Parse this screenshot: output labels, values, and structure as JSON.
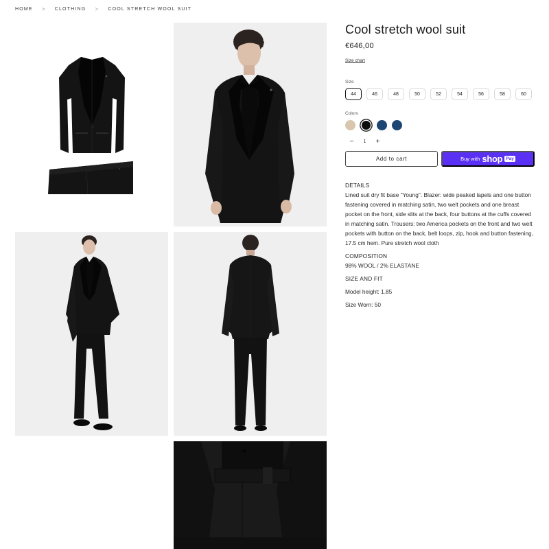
{
  "breadcrumb": {
    "items": [
      "HOME",
      "CLOTHING",
      "COOL STRETCH WOOL SUIT"
    ],
    "separator": ">"
  },
  "product": {
    "title": "Cool stretch wool suit",
    "price": "€646,00",
    "size_chart_label": "Size chart",
    "size_label": "Size",
    "sizes": [
      "44",
      "46",
      "48",
      "50",
      "52",
      "54",
      "56",
      "58",
      "60"
    ],
    "selected_size": "44",
    "colors_label": "Colors",
    "colors": [
      "#d8c7ae",
      "#0d0d0d",
      "#1d4673",
      "#1d4673"
    ],
    "selected_color_index": 1,
    "quantity": "1",
    "qty_minus": "−",
    "qty_plus": "+",
    "add_to_cart": "Add to cart",
    "buy_with": "Buy with",
    "shop_word": "shop",
    "pay_word": "Pay"
  },
  "details": {
    "details_heading": "DETAILS",
    "description": "Lined suit dry fit base \"Young\". Blazer: wide peaked lapels and one button fastening covered in matching satin, two welt pockets and one breast pocket on the front, side slits at the back, four buttons at the cuffs covered in matching satin. Trousers: two America pockets on the front and two welt pockets with button on the back, belt loops, zip, hook and button fastening, 17.5 cm hem. Pure stretch wool cloth",
    "composition_heading": "COMPOSITION",
    "composition": "98% WOOL / 2% ELASTANE",
    "size_fit_heading": "SIZE AND FIT",
    "model_height": "Model height: 1.85",
    "size_worn": "Size Worn: 50"
  },
  "colors": {
    "shop_pay": "#5a31f4",
    "text": "#1a1a1a"
  }
}
